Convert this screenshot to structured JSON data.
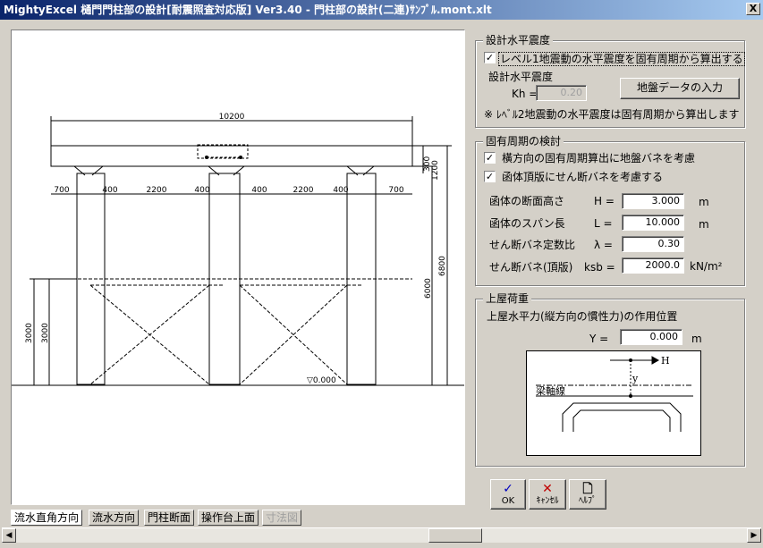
{
  "window": {
    "title": "MightyExcel 樋門門柱部の設計[耐震照査対応版] Ver3.40 - 門柱部の設計(二連)ｻﾝﾌﾟﾙ.mont.xlt",
    "close_label": "X"
  },
  "drawing": {
    "dim_total_width": "10200",
    "dims_row": [
      "700",
      "400",
      "2200",
      "400",
      "400",
      "2200",
      "400",
      "700"
    ],
    "dim_beam_depth_a": "300",
    "dim_beam_depth_b": "1200",
    "dim_column_height": "6000",
    "dim_total_height": "6800",
    "dim_lower": "3000",
    "level_label": "▽0.000"
  },
  "tabs": [
    {
      "label": "流水直角方向",
      "active": true,
      "disabled": false
    },
    {
      "label": "流水方向",
      "active": false,
      "disabled": false
    },
    {
      "label": "門柱断面",
      "active": false,
      "disabled": false
    },
    {
      "label": "操作台上面",
      "active": false,
      "disabled": false
    },
    {
      "label": "寸法図",
      "active": false,
      "disabled": true
    }
  ],
  "seismic": {
    "title": "設計水平震度",
    "checkbox_label": "レベル1地震動の水平震度を固有周期から算出する",
    "checkbox_checked": "✓",
    "sub_label": "設計水平震度",
    "kh_label": "Kh =",
    "kh_value": "0.20",
    "ground_button": "地盤データの入力",
    "note": "※ ﾚﾍﾞﾙ2地震動の水平震度は固有周期から算出します"
  },
  "period": {
    "title": "固有周期の検討",
    "cb1_label": "橫方向の固有周期算出に地盤バネを考慮",
    "cb1_checked": "✓",
    "cb2_label": "函体頂版にせん断バネを考慮する",
    "cb2_checked": "✓",
    "rows": [
      {
        "label": "函体の断面高さ",
        "sym": "H =",
        "value": "3.000",
        "unit": "m"
      },
      {
        "label": "函体のスパン長",
        "sym": "L =",
        "value": "10.000",
        "unit": "m"
      },
      {
        "label": "せん断バネ定数比",
        "sym": "λ =",
        "value": "0.30",
        "unit": ""
      },
      {
        "label": "せん断バネ(頂版)",
        "sym": "ksb =",
        "value": "2000.0",
        "unit": "kN/m²"
      }
    ]
  },
  "upper": {
    "title": "上屋荷重",
    "desc": "上屋水平力(縦方向の慣性力)の作用位置",
    "y_label": "Y =",
    "y_value": "0.000",
    "y_unit": "m",
    "diagram_h": "H",
    "diagram_y": "y",
    "diagram_axis": "梁軸線"
  },
  "buttons": {
    "ok_label": "OK",
    "cancel_label": "ｷｬﾝｾﾙ",
    "help_label": "ﾍﾙﾌﾟ"
  },
  "colors": {
    "ok_icon": "#0000c0",
    "cancel_icon": "#c00000"
  },
  "icons": {
    "ok": "check-icon",
    "cancel": "cross-icon",
    "help": "document-icon"
  }
}
